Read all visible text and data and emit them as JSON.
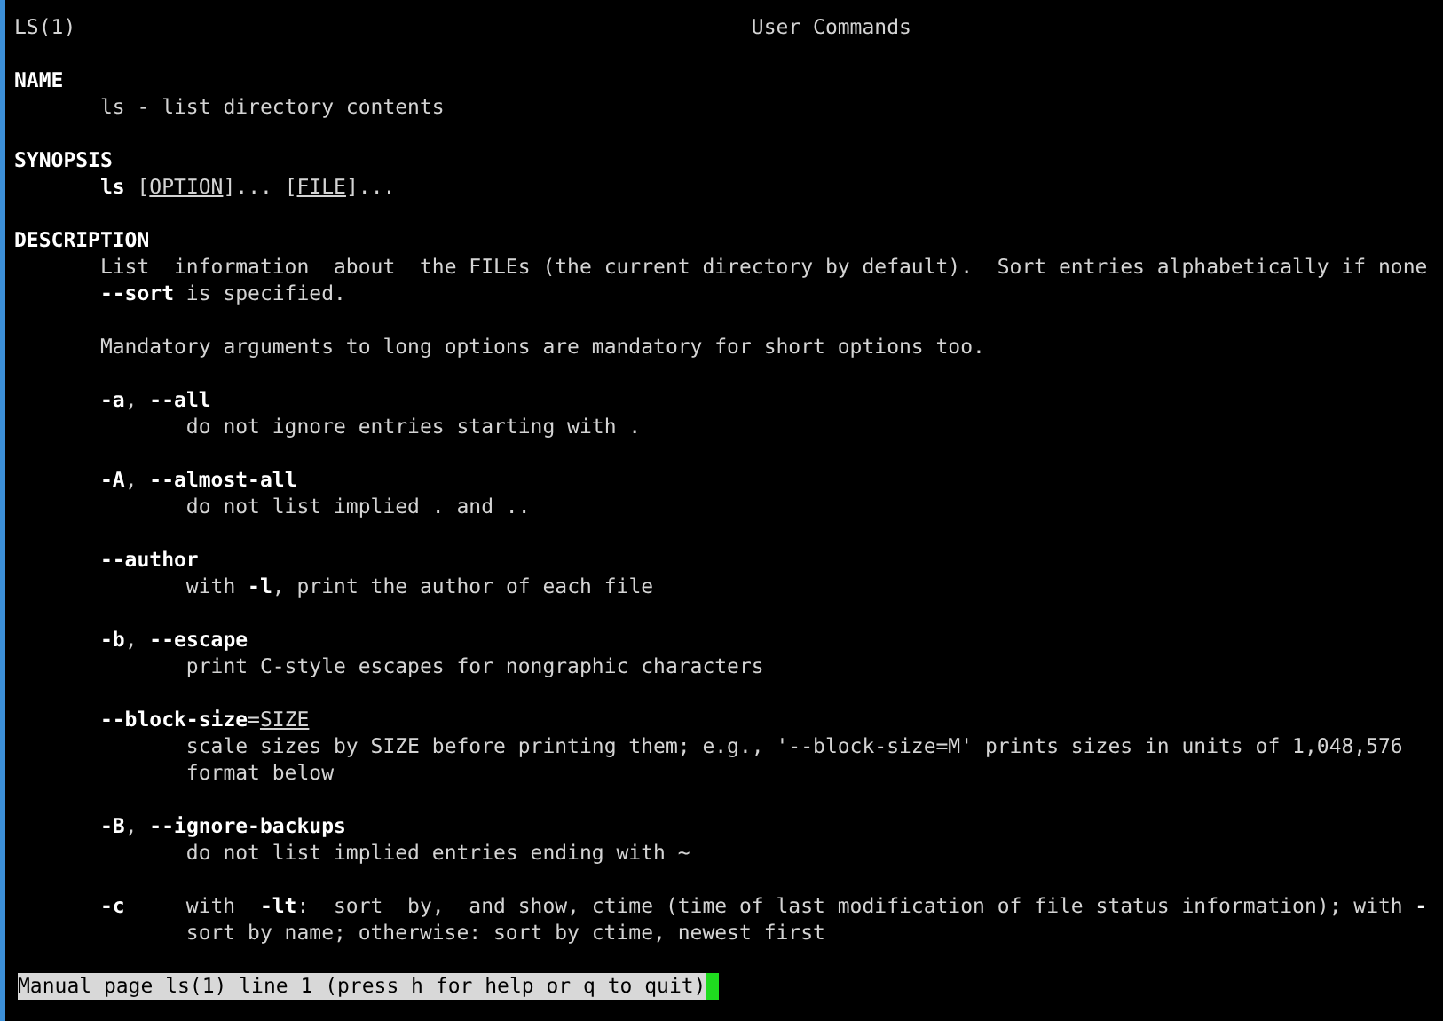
{
  "header": {
    "left": "LS(1)",
    "center": "User Commands"
  },
  "sections": [
    {
      "title": "NAME",
      "blocks": [
        {
          "kind": "paragraph",
          "lines": [
            "ls - list directory contents"
          ]
        }
      ]
    },
    {
      "title": "SYNOPSIS",
      "blocks": [
        {
          "kind": "paragraph",
          "lines": [
            {
              "segments": [
                {
                  "text": "ls",
                  "kind": "bold"
                },
                {
                  "text": " [",
                  "kind": "plain"
                },
                {
                  "text": "OPTION",
                  "kind": "underline"
                },
                {
                  "text": "]... [",
                  "kind": "plain"
                },
                {
                  "text": "FILE",
                  "kind": "underline"
                },
                {
                  "text": "]...",
                  "kind": "plain"
                }
              ]
            }
          ]
        }
      ]
    },
    {
      "title": "DESCRIPTION",
      "blocks": [
        {
          "kind": "paragraph",
          "lines": [
            "List  information  about  the FILEs (the current directory by default).  Sort entries alphabetically if none",
            "**--sort** is specified."
          ]
        },
        {
          "kind": "paragraph",
          "lines": [
            "Mandatory arguments to long options are mandatory for short options too."
          ]
        },
        {
          "kind": "option",
          "term": "**-a**, **--all**",
          "lines": [
            "do not ignore entries starting with ."
          ]
        },
        {
          "kind": "option",
          "term": "**-A**, **--almost-all**",
          "lines": [
            "do not list implied . and .."
          ]
        },
        {
          "kind": "option",
          "term": "**--author**",
          "lines": [
            "with **-l**, print the author of each file"
          ]
        },
        {
          "kind": "option",
          "term": "**-b**, **--escape**",
          "lines": [
            "print C-style escapes for nongraphic characters"
          ]
        },
        {
          "kind": "option",
          "term": {
            "segments": [
              {
                "text": "--block-size",
                "kind": "bold"
              },
              {
                "text": "=",
                "kind": "plain"
              },
              {
                "text": "SIZE",
                "kind": "underline"
              }
            ]
          },
          "lines": [
            "scale sizes by SIZE before printing them; e.g., '--block-size=M' prints sizes in units of 1,048,576",
            "format below"
          ]
        },
        {
          "kind": "option",
          "term": "**-B**, **--ignore-backups**",
          "lines": [
            "do not list implied entries ending with ~"
          ]
        },
        {
          "kind": "inline_option",
          "term": "**-c**",
          "lines": [
            "with  **-lt**:  sort  by,  and show, ctime (time of last modification of file status information); with **-**",
            "sort by name; otherwise: sort by ctime, newest first"
          ]
        }
      ]
    }
  ],
  "status": {
    "text": "Manual page ls(1) line 1 (press h for help or q to quit)"
  }
}
